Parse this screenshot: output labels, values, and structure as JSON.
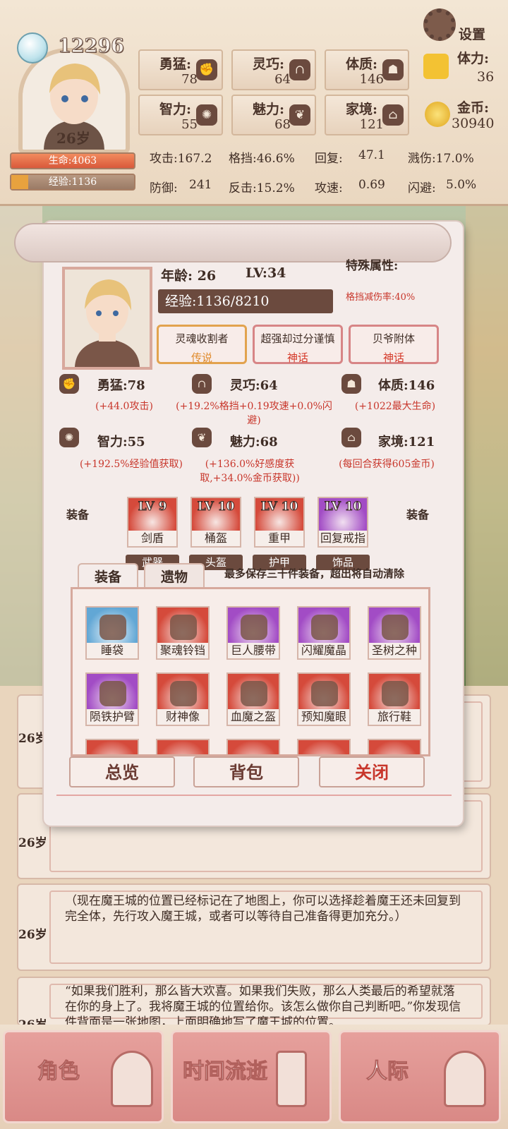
{
  "header": {
    "score": "12296",
    "age": "26岁",
    "settings": "设置",
    "hp": "生命:4063",
    "xp": "经验:1136",
    "xp_fill": 0.14
  },
  "stats": [
    {
      "label": "勇猛:",
      "value": "78",
      "icon": "fist-icon"
    },
    {
      "label": "灵巧:",
      "value": "64",
      "icon": "cloak-icon"
    },
    {
      "label": "体质:",
      "value": "146",
      "icon": "arm-icon"
    },
    {
      "label": "智力:",
      "value": "55",
      "icon": "brain-icon"
    },
    {
      "label": "魅力:",
      "value": "68",
      "icon": "lotus-icon"
    },
    {
      "label": "家境:",
      "value": "121",
      "icon": "house-icon"
    }
  ],
  "resources": {
    "stamina_label": "体力:",
    "stamina": "36",
    "gold_label": "金币:",
    "gold": "30940"
  },
  "derived": {
    "r1": [
      "攻击:167.2",
      "格挡:46.6%",
      "回复:",
      "47.1",
      "溅伤:17.0%"
    ],
    "r2": [
      "防御:",
      "241",
      "反击:15.2%",
      "攻速:",
      "0.69",
      "闪避:",
      "5.0%"
    ]
  },
  "modal": {
    "age": "年龄: 26",
    "lv": "LV:34",
    "special_title": "特殊属性:",
    "special_1": "格挡减伤率:40%",
    "exp": "经验:1136/8210",
    "tags": [
      {
        "name": "灵魂收割者",
        "rarity": "传说"
      },
      {
        "name": "超强却过分谨慎",
        "rarity": "神话"
      },
      {
        "name": "贝爷附体",
        "rarity": "神话"
      }
    ],
    "attrs": [
      {
        "label": "勇猛:78",
        "desc": "(+44.0攻击)"
      },
      {
        "label": "灵巧:64",
        "desc": "(+19.2%格挡+0.19攻速+0.0%闪避)"
      },
      {
        "label": "体质:146",
        "desc": "(+1022最大生命)"
      },
      {
        "label": "智力:55",
        "desc": "(+192.5%经验值获取)"
      },
      {
        "label": "魅力:68",
        "desc": "(+136.0%好感度获取,+34.0%金币获取))"
      },
      {
        "label": "家境:121",
        "desc": "(每回合获得605金币)"
      }
    ],
    "equip_label": "装备",
    "equipped": [
      {
        "lv": "LV 9",
        "name": "剑盾",
        "slot": "武器"
      },
      {
        "lv": "LV 10",
        "name": "桶盔",
        "slot": "头盔"
      },
      {
        "lv": "LV 10",
        "name": "重甲",
        "slot": "护甲"
      },
      {
        "lv": "LV 10",
        "name": "回复戒指",
        "slot": "饰品"
      }
    ],
    "tabs": [
      "装备",
      "遗物"
    ],
    "bag_note": "最多保存三十件装备，超出将自动清除",
    "items": [
      {
        "name": "睡袋",
        "color": "blue"
      },
      {
        "name": "聚魂铃铛",
        "color": "red"
      },
      {
        "name": "巨人腰带",
        "color": "pur"
      },
      {
        "name": "闪耀魔晶",
        "color": "pur"
      },
      {
        "name": "圣树之种",
        "color": "pur"
      },
      {
        "name": "陨铁护臂",
        "color": "pur"
      },
      {
        "name": "财神像",
        "color": "red"
      },
      {
        "name": "血魔之盔",
        "color": "red"
      },
      {
        "name": "预知魔眼",
        "color": "red"
      },
      {
        "name": "旅行鞋",
        "color": "red"
      }
    ],
    "buttons": [
      "总览",
      "背包",
      "关闭"
    ]
  },
  "logs": [
    {
      "age": "26岁",
      "text": ""
    },
    {
      "age": "26岁",
      "text": ""
    },
    {
      "age": "26岁",
      "text": "（现在魔王城的位置已经标记在了地图上，你可以选择趁着魔王还未回复到完全体，先行攻入魔王城，或者可以等待自己准备得更加充分。）"
    },
    {
      "age": "26岁",
      "text": "“如果我们胜利，那么皆大欢喜。如果我们失败，那么人类最后的希望就落在你的身上了。我将魔王城的位置给你。该怎么做你自己判断吧。”你发现信件背面是一张地图，上面明确地写了魔王城的位置。"
    }
  ],
  "nav": [
    "角色",
    "时间流逝",
    "人际"
  ]
}
